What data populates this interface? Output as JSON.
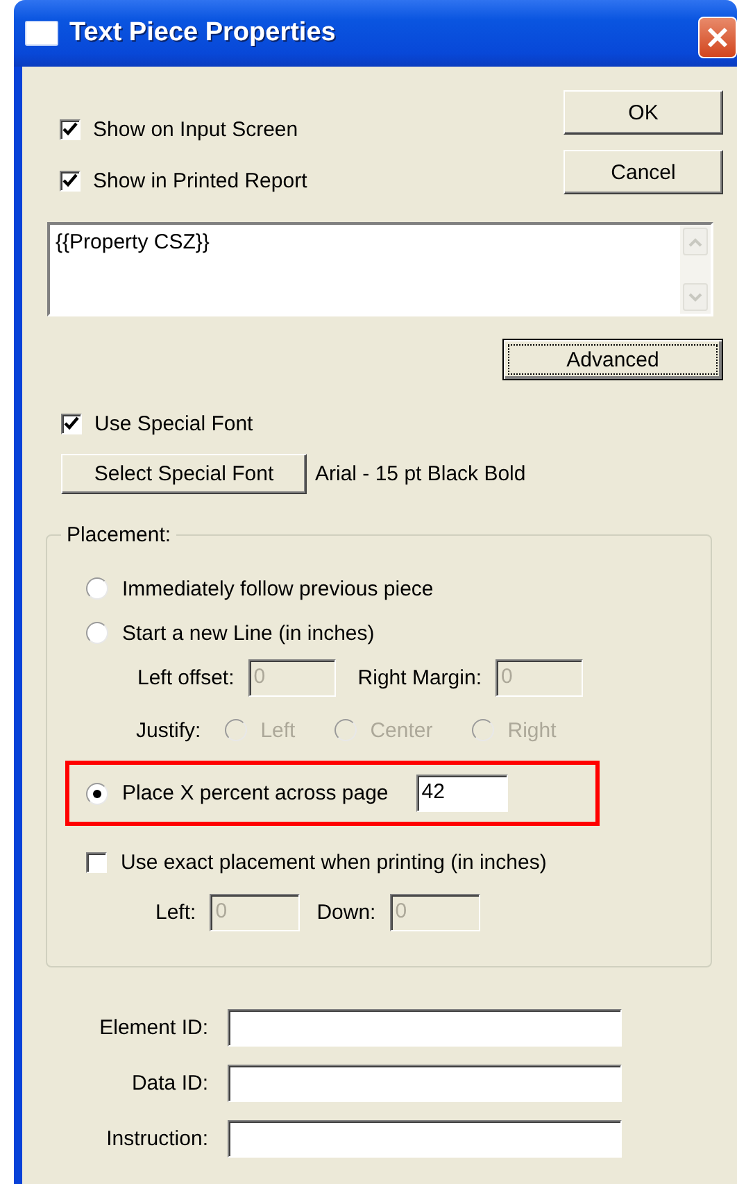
{
  "window": {
    "title": "Text Piece Properties"
  },
  "buttons": [
    {
      "label": "OK",
      "focused": false
    },
    {
      "label": "Cancel",
      "focused": false
    }
  ],
  "options": [
    {
      "label": "Show on Input Screen",
      "checked": true
    },
    {
      "label": "Show in Printed Report",
      "checked": true
    }
  ],
  "text_box": {
    "value": "{{Property CSZ}}"
  },
  "advanced_button": {
    "label": "Advanced",
    "focused": true
  },
  "special_font": {
    "label": "Use Special Font",
    "checked": true,
    "button": "Select Special Font",
    "description": "Arial - 15 pt Black Bold"
  },
  "placement": {
    "title": "Placement:",
    "rows": [
      {
        "kind": "radio",
        "label": "Immediately follow previous piece",
        "selected": false
      },
      {
        "kind": "radio",
        "label": "Start a new Line (in inches)",
        "selected": false
      },
      {
        "kind": "fields",
        "fields": [
          {
            "label": "Left offset:",
            "value": "0",
            "disabled": true
          },
          {
            "label": "Right Margin:",
            "value": "0",
            "disabled": true
          }
        ]
      },
      {
        "kind": "radio_group",
        "label": "Justify:",
        "options": [
          {
            "label": "Left",
            "selected": false,
            "disabled": true
          },
          {
            "label": "Center",
            "selected": false,
            "disabled": true
          },
          {
            "label": "Right",
            "selected": false,
            "disabled": true
          }
        ]
      },
      {
        "kind": "radio",
        "label": "Place X percent across page",
        "selected": true,
        "highlighted": true,
        "value": "42"
      },
      {
        "kind": "checkbox",
        "label": "Use exact placement when printing (in inches)",
        "checked": false
      },
      {
        "kind": "fields",
        "fields": [
          {
            "label": "Left:",
            "value": "0",
            "disabled": true
          },
          {
            "label": "Down:",
            "value": "0",
            "disabled": true
          }
        ]
      }
    ]
  },
  "id_fields": [
    {
      "label": "Element ID:"
    },
    {
      "label": "Data ID:"
    },
    {
      "label": "Instruction:"
    }
  ]
}
